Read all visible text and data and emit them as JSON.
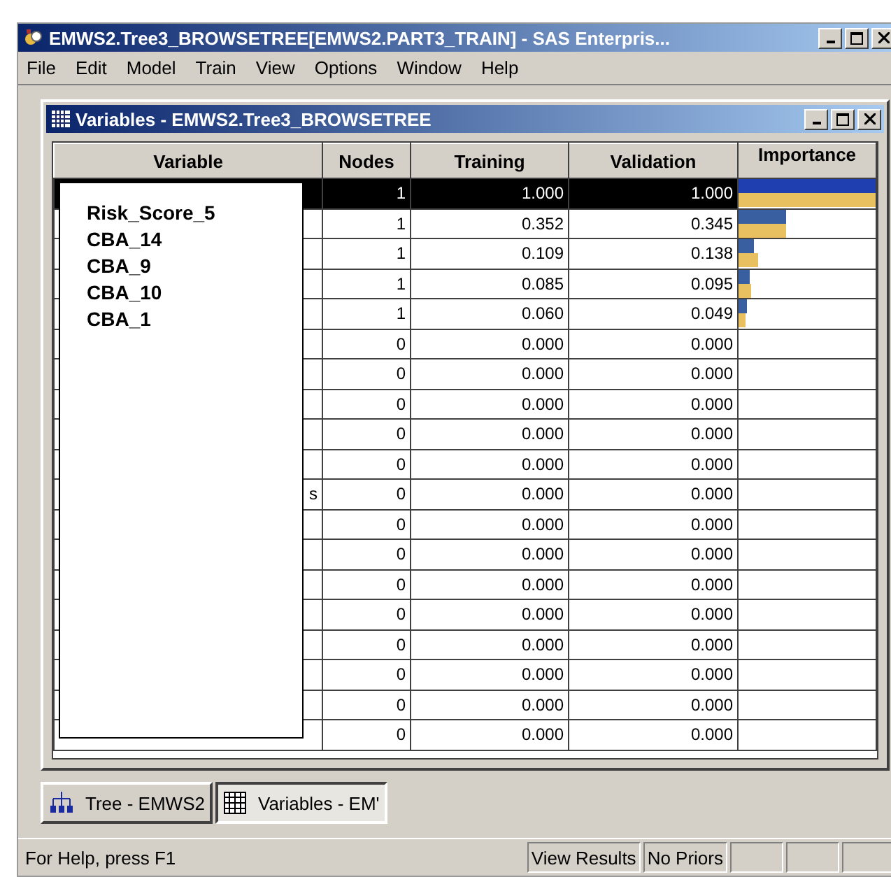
{
  "window": {
    "title": "EMWS2.Tree3_BROWSETREE[EMWS2.PART3_TRAIN] - SAS Enterpris..."
  },
  "menu": [
    "File",
    "Edit",
    "Model",
    "Train",
    "View",
    "Options",
    "Window",
    "Help"
  ],
  "child_window": {
    "title": "Variables - EMWS2.Tree3_BROWSETREE"
  },
  "table": {
    "columns": [
      "Variable",
      "Nodes",
      "Training",
      "Validation",
      "Importance"
    ],
    "rows": [
      {
        "nodes": "1",
        "training": "1.000",
        "validation": "1.000",
        "selected": true,
        "importance": [
          {
            "kind": "training",
            "level": 1.0
          },
          {
            "kind": "validation",
            "level": 1.0
          }
        ]
      },
      {
        "nodes": "1",
        "training": "0.352",
        "validation": "0.345",
        "selected": false,
        "importance": [
          {
            "kind": "training",
            "level": 0.352
          },
          {
            "kind": "validation",
            "level": 0.345
          }
        ]
      },
      {
        "nodes": "1",
        "training": "0.109",
        "validation": "0.138",
        "selected": false,
        "importance": [
          {
            "kind": "training",
            "level": 0.109
          },
          {
            "kind": "validation",
            "level": 0.138
          }
        ]
      },
      {
        "nodes": "1",
        "training": "0.085",
        "validation": "0.095",
        "selected": false,
        "importance": [
          {
            "kind": "training",
            "level": 0.085
          },
          {
            "kind": "validation",
            "level": 0.095
          }
        ]
      },
      {
        "nodes": "1",
        "training": "0.060",
        "validation": "0.049",
        "selected": false,
        "importance": [
          {
            "kind": "training",
            "level": 0.06
          },
          {
            "kind": "validation",
            "level": 0.049
          }
        ]
      },
      {
        "nodes": "0",
        "training": "0.000",
        "validation": "0.000",
        "selected": false
      },
      {
        "nodes": "0",
        "training": "0.000",
        "validation": "0.000",
        "selected": false
      },
      {
        "nodes": "0",
        "training": "0.000",
        "validation": "0.000",
        "selected": false
      },
      {
        "nodes": "0",
        "training": "0.000",
        "validation": "0.000",
        "selected": false
      },
      {
        "nodes": "0",
        "training": "0.000",
        "validation": "0.000",
        "selected": false
      },
      {
        "variable": "s",
        "nodes": "0",
        "training": "0.000",
        "validation": "0.000",
        "selected": false
      },
      {
        "nodes": "0",
        "training": "0.000",
        "validation": "0.000",
        "selected": false
      },
      {
        "nodes": "0",
        "training": "0.000",
        "validation": "0.000",
        "selected": false
      },
      {
        "nodes": "0",
        "training": "0.000",
        "validation": "0.000",
        "selected": false
      },
      {
        "nodes": "0",
        "training": "0.000",
        "validation": "0.000",
        "selected": false
      },
      {
        "nodes": "0",
        "training": "0.000",
        "validation": "0.000",
        "selected": false
      },
      {
        "nodes": "0",
        "training": "0.000",
        "validation": "0.000",
        "selected": false
      },
      {
        "nodes": "0",
        "training": "0.000",
        "validation": "0.000",
        "selected": false
      },
      {
        "nodes": "0",
        "training": "0.000",
        "validation": "0.000",
        "selected": false
      }
    ]
  },
  "overlay": {
    "items": [
      "Risk_Score_5",
      "CBA_14",
      "CBA_9",
      "CBA_10",
      "CBA_1"
    ]
  },
  "taskbar": [
    {
      "label": "Tree - EMWS2",
      "kind": "tree",
      "selected": false
    },
    {
      "label": "Variables - EM'",
      "kind": "table",
      "selected": true
    }
  ],
  "status_bar": {
    "message": "For Help, press F1",
    "panels": [
      "View Results",
      "No Priors"
    ]
  }
}
